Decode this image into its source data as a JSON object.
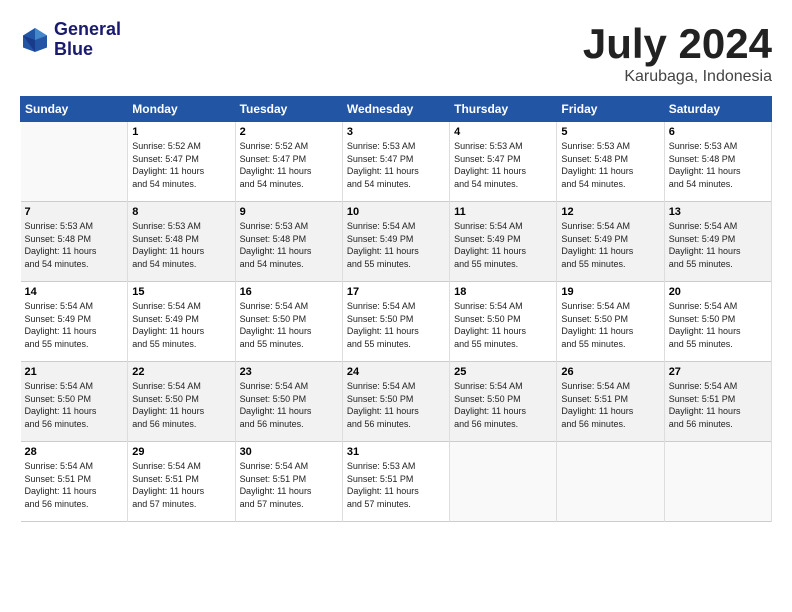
{
  "header": {
    "logo_line1": "General",
    "logo_line2": "Blue",
    "month": "July 2024",
    "location": "Karubaga, Indonesia"
  },
  "weekdays": [
    "Sunday",
    "Monday",
    "Tuesday",
    "Wednesday",
    "Thursday",
    "Friday",
    "Saturday"
  ],
  "weeks": [
    [
      {
        "day": "",
        "info": ""
      },
      {
        "day": "1",
        "info": "Sunrise: 5:52 AM\nSunset: 5:47 PM\nDaylight: 11 hours\nand 54 minutes."
      },
      {
        "day": "2",
        "info": "Sunrise: 5:52 AM\nSunset: 5:47 PM\nDaylight: 11 hours\nand 54 minutes."
      },
      {
        "day": "3",
        "info": "Sunrise: 5:53 AM\nSunset: 5:47 PM\nDaylight: 11 hours\nand 54 minutes."
      },
      {
        "day": "4",
        "info": "Sunrise: 5:53 AM\nSunset: 5:47 PM\nDaylight: 11 hours\nand 54 minutes."
      },
      {
        "day": "5",
        "info": "Sunrise: 5:53 AM\nSunset: 5:48 PM\nDaylight: 11 hours\nand 54 minutes."
      },
      {
        "day": "6",
        "info": "Sunrise: 5:53 AM\nSunset: 5:48 PM\nDaylight: 11 hours\nand 54 minutes."
      }
    ],
    [
      {
        "day": "7",
        "info": "Sunrise: 5:53 AM\nSunset: 5:48 PM\nDaylight: 11 hours\nand 54 minutes."
      },
      {
        "day": "8",
        "info": "Sunrise: 5:53 AM\nSunset: 5:48 PM\nDaylight: 11 hours\nand 54 minutes."
      },
      {
        "day": "9",
        "info": "Sunrise: 5:53 AM\nSunset: 5:48 PM\nDaylight: 11 hours\nand 54 minutes."
      },
      {
        "day": "10",
        "info": "Sunrise: 5:54 AM\nSunset: 5:49 PM\nDaylight: 11 hours\nand 55 minutes."
      },
      {
        "day": "11",
        "info": "Sunrise: 5:54 AM\nSunset: 5:49 PM\nDaylight: 11 hours\nand 55 minutes."
      },
      {
        "day": "12",
        "info": "Sunrise: 5:54 AM\nSunset: 5:49 PM\nDaylight: 11 hours\nand 55 minutes."
      },
      {
        "day": "13",
        "info": "Sunrise: 5:54 AM\nSunset: 5:49 PM\nDaylight: 11 hours\nand 55 minutes."
      }
    ],
    [
      {
        "day": "14",
        "info": "Sunrise: 5:54 AM\nSunset: 5:49 PM\nDaylight: 11 hours\nand 55 minutes."
      },
      {
        "day": "15",
        "info": "Sunrise: 5:54 AM\nSunset: 5:49 PM\nDaylight: 11 hours\nand 55 minutes."
      },
      {
        "day": "16",
        "info": "Sunrise: 5:54 AM\nSunset: 5:50 PM\nDaylight: 11 hours\nand 55 minutes."
      },
      {
        "day": "17",
        "info": "Sunrise: 5:54 AM\nSunset: 5:50 PM\nDaylight: 11 hours\nand 55 minutes."
      },
      {
        "day": "18",
        "info": "Sunrise: 5:54 AM\nSunset: 5:50 PM\nDaylight: 11 hours\nand 55 minutes."
      },
      {
        "day": "19",
        "info": "Sunrise: 5:54 AM\nSunset: 5:50 PM\nDaylight: 11 hours\nand 55 minutes."
      },
      {
        "day": "20",
        "info": "Sunrise: 5:54 AM\nSunset: 5:50 PM\nDaylight: 11 hours\nand 55 minutes."
      }
    ],
    [
      {
        "day": "21",
        "info": "Sunrise: 5:54 AM\nSunset: 5:50 PM\nDaylight: 11 hours\nand 56 minutes."
      },
      {
        "day": "22",
        "info": "Sunrise: 5:54 AM\nSunset: 5:50 PM\nDaylight: 11 hours\nand 56 minutes."
      },
      {
        "day": "23",
        "info": "Sunrise: 5:54 AM\nSunset: 5:50 PM\nDaylight: 11 hours\nand 56 minutes."
      },
      {
        "day": "24",
        "info": "Sunrise: 5:54 AM\nSunset: 5:50 PM\nDaylight: 11 hours\nand 56 minutes."
      },
      {
        "day": "25",
        "info": "Sunrise: 5:54 AM\nSunset: 5:50 PM\nDaylight: 11 hours\nand 56 minutes."
      },
      {
        "day": "26",
        "info": "Sunrise: 5:54 AM\nSunset: 5:51 PM\nDaylight: 11 hours\nand 56 minutes."
      },
      {
        "day": "27",
        "info": "Sunrise: 5:54 AM\nSunset: 5:51 PM\nDaylight: 11 hours\nand 56 minutes."
      }
    ],
    [
      {
        "day": "28",
        "info": "Sunrise: 5:54 AM\nSunset: 5:51 PM\nDaylight: 11 hours\nand 56 minutes."
      },
      {
        "day": "29",
        "info": "Sunrise: 5:54 AM\nSunset: 5:51 PM\nDaylight: 11 hours\nand 57 minutes."
      },
      {
        "day": "30",
        "info": "Sunrise: 5:54 AM\nSunset: 5:51 PM\nDaylight: 11 hours\nand 57 minutes."
      },
      {
        "day": "31",
        "info": "Sunrise: 5:53 AM\nSunset: 5:51 PM\nDaylight: 11 hours\nand 57 minutes."
      },
      {
        "day": "",
        "info": ""
      },
      {
        "day": "",
        "info": ""
      },
      {
        "day": "",
        "info": ""
      }
    ]
  ]
}
